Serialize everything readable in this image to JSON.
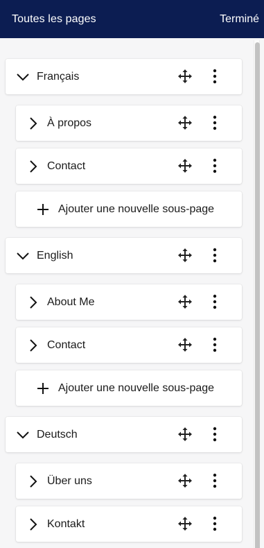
{
  "header": {
    "title": "Toutes les pages",
    "done_label": "Terminé"
  },
  "colors": {
    "header_bg": "#0c1d52",
    "panel_bg": "#f6f6f7",
    "row_bg": "#ffffff"
  },
  "languages": [
    {
      "label": "Français",
      "subpages": [
        "À propos",
        "Contact"
      ],
      "add_label": "Ajouter une nouvelle sous-page"
    },
    {
      "label": "English",
      "subpages": [
        "About Me",
        "Contact"
      ],
      "add_label": "Ajouter une nouvelle sous-page"
    },
    {
      "label": "Deutsch",
      "subpages": [
        "Über uns",
        "Kontakt"
      ]
    }
  ],
  "icons": {
    "expanded": "chevron-down-icon",
    "collapsed": "chevron-right-icon",
    "move": "move-icon",
    "more": "kebab-menu-icon",
    "add": "plus-icon"
  }
}
